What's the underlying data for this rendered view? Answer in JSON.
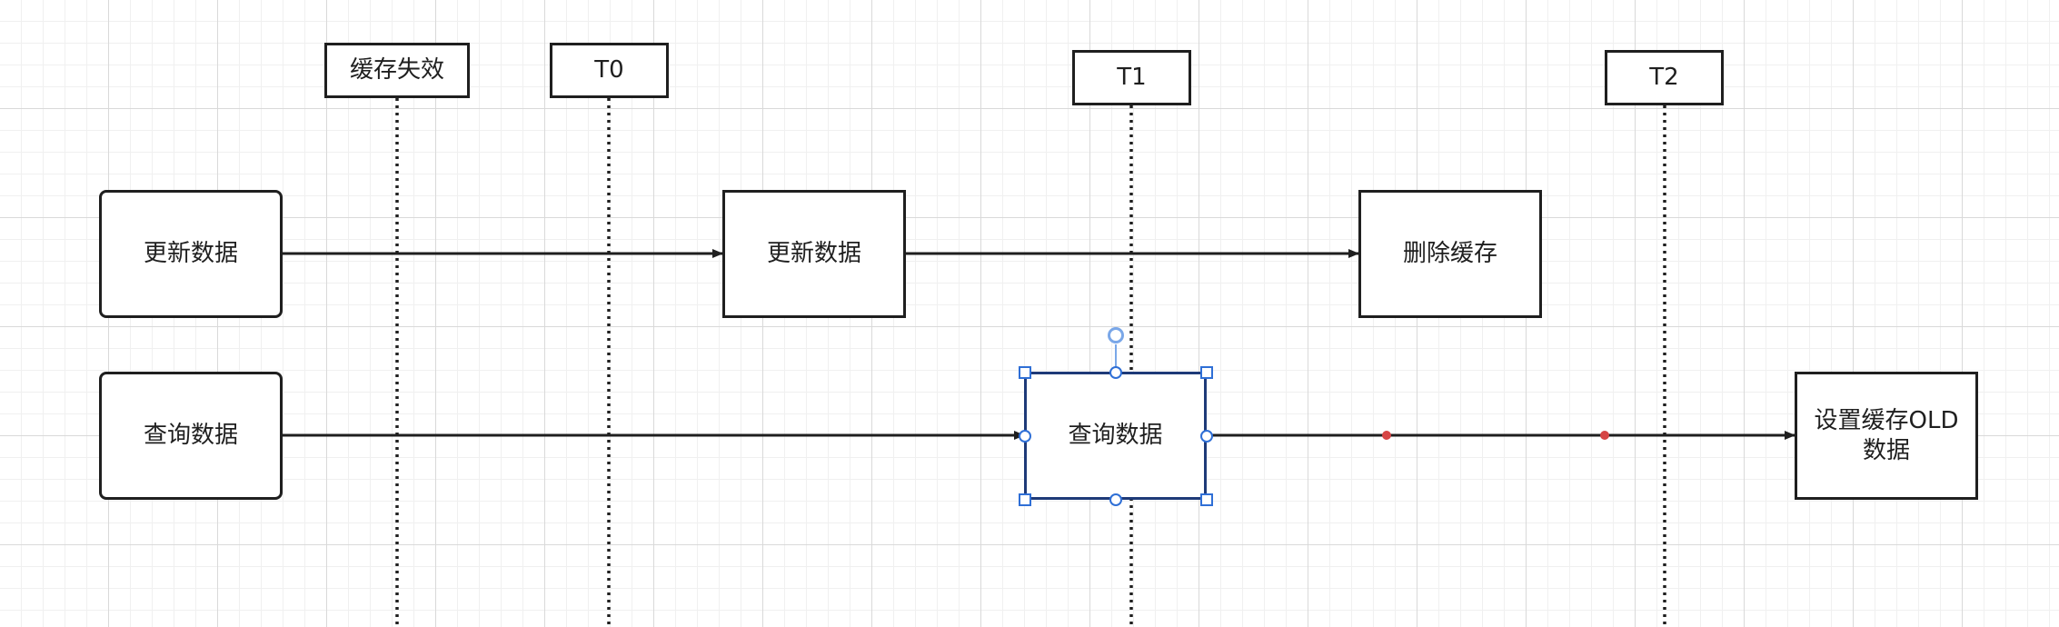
{
  "colors": {
    "stroke": "#1f1f1f",
    "selection": "#2f6fd6",
    "selection_border": "#1e3a78",
    "waypoint": "#d64545",
    "grid_major": "#d9d9d9",
    "grid_minor": "#f0f0f0"
  },
  "timeline_labels": {
    "cache_expire": "缓存失效",
    "t0": "T0",
    "t1": "T1",
    "t2": "T2"
  },
  "nodes": {
    "update_start": "更新数据",
    "update_mid": "更新数据",
    "delete_cache": "删除缓存",
    "query_start": "查询数据",
    "query_mid": "查询数据",
    "set_cache_old": "设置缓存OLD数据"
  }
}
